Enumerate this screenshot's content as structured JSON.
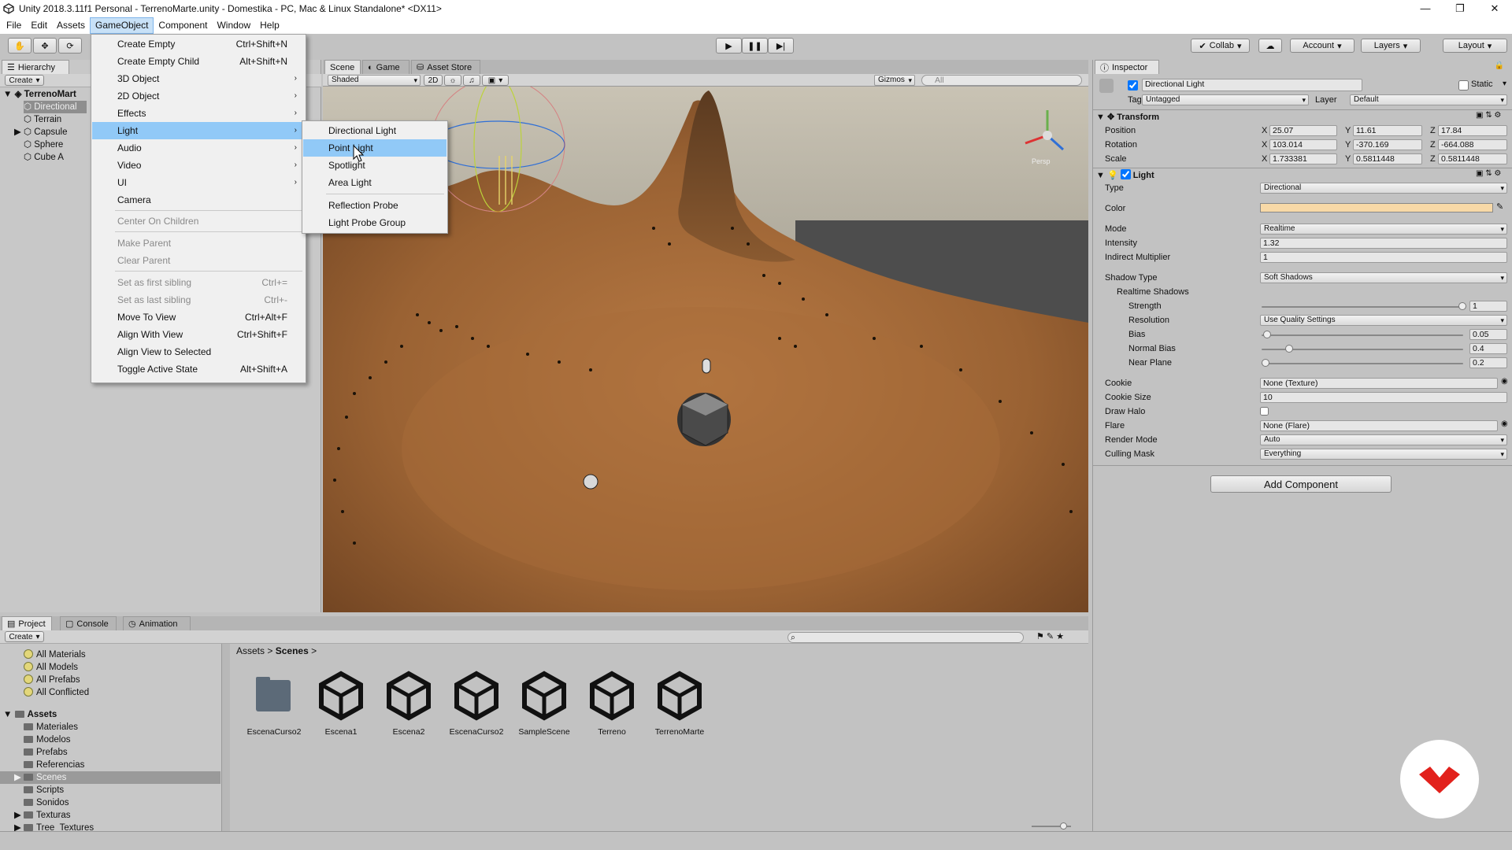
{
  "window": {
    "title": "Unity 2018.3.11f1 Personal - TerrenoMarte.unity - Domestika - PC, Mac & Linux Standalone* <DX11>",
    "controls": [
      "minimize-icon",
      "maximize-icon",
      "close-icon"
    ]
  },
  "menubar": [
    "File",
    "Edit",
    "Assets",
    "GameObject",
    "Component",
    "Window",
    "Help"
  ],
  "toolbar": {
    "collab": "Collab",
    "account": "Account",
    "layers": "Layers",
    "layout": "Layout"
  },
  "hierarchy": {
    "tab": "Hierarchy",
    "create": "Create",
    "scene_name": "TerrenoMart",
    "items": [
      "Directional",
      "Terrain",
      "Capsule",
      "Sphere",
      "Cube A"
    ]
  },
  "scene_view": {
    "tabs": [
      "Scene",
      "Game",
      "Asset Store"
    ],
    "shading": "Shaded",
    "mode_2d": "2D",
    "gizmos": "Gizmos",
    "search_placeholder": "All",
    "persp": "Persp"
  },
  "gameobject_menu": {
    "items": [
      {
        "label": "Create Empty",
        "shortcut": "Ctrl+Shift+N"
      },
      {
        "label": "Create Empty Child",
        "shortcut": "Alt+Shift+N"
      },
      {
        "label": "3D Object",
        "submenu": true
      },
      {
        "label": "2D Object",
        "submenu": true
      },
      {
        "label": "Effects",
        "submenu": true
      },
      {
        "label": "Light",
        "submenu": true
      },
      {
        "label": "Audio",
        "submenu": true
      },
      {
        "label": "Video",
        "submenu": true
      },
      {
        "label": "UI",
        "submenu": true
      },
      {
        "label": "Camera"
      },
      {
        "label": "Center On Children"
      },
      {
        "label": "Make Parent"
      },
      {
        "label": "Clear Parent"
      },
      {
        "label": "Set as first sibling",
        "shortcut": "Ctrl+="
      },
      {
        "label": "Set as last sibling",
        "shortcut": "Ctrl+-"
      },
      {
        "label": "Move To View",
        "shortcut": "Ctrl+Alt+F"
      },
      {
        "label": "Align With View",
        "shortcut": "Ctrl+Shift+F"
      },
      {
        "label": "Align View to Selected"
      },
      {
        "label": "Toggle Active State",
        "shortcut": "Alt+Shift+A"
      }
    ]
  },
  "light_submenu": [
    "Directional Light",
    "Point Light",
    "Spotlight",
    "Area Light",
    "Reflection Probe",
    "Light Probe Group"
  ],
  "inspector": {
    "tab": "Inspector",
    "object_name": "Directional Light",
    "static": "Static",
    "tag_label": "Tag",
    "tag": "Untagged",
    "layer_label": "Layer",
    "layer": "Default",
    "transform": {
      "title": "Transform",
      "position_label": "Position",
      "rotation_label": "Rotation",
      "scale_label": "Scale",
      "position": [
        "25.07",
        "11.61",
        "17.84"
      ],
      "rotation": [
        "103.014",
        "-370.169",
        "-664.088"
      ],
      "scale": [
        "1.733381",
        "0.5811448",
        "0.5811448"
      ]
    },
    "light": {
      "title": "Light",
      "type_label": "Type",
      "type": "Directional",
      "color_label": "Color",
      "color": "#f8d9a7",
      "mode_label": "Mode",
      "mode": "Realtime",
      "intensity_label": "Intensity",
      "intensity": "1.32",
      "indirect_label": "Indirect Multiplier",
      "indirect": "1",
      "shadow_type_label": "Shadow Type",
      "shadow_type": "Soft Shadows",
      "realtime_shadows": "Realtime Shadows",
      "strength_label": "Strength",
      "strength": "1",
      "resolution_label": "Resolution",
      "resolution": "Use Quality Settings",
      "bias_label": "Bias",
      "bias": "0.05",
      "normal_bias_label": "Normal Bias",
      "normal_bias": "0.4",
      "near_plane_label": "Near Plane",
      "near_plane": "0.2",
      "cookie_label": "Cookie",
      "cookie": "None (Texture)",
      "cookie_size_label": "Cookie Size",
      "cookie_size": "10",
      "draw_halo_label": "Draw Halo",
      "flare_label": "Flare",
      "flare": "None (Flare)",
      "render_mode_label": "Render Mode",
      "render_mode": "Auto",
      "culling_mask_label": "Culling Mask",
      "culling_mask": "Everything"
    },
    "add_component": "Add Component"
  },
  "project": {
    "tabs": [
      "Project",
      "Console",
      "Animation"
    ],
    "create": "Create",
    "favorites": [
      "All Materials",
      "All Models",
      "All Prefabs",
      "All Conflicted"
    ],
    "assets_root": "Assets",
    "folders": [
      "Materiales",
      "Modelos",
      "Prefabs",
      "Referencias",
      "Scenes",
      "Scripts",
      "Sonidos",
      "Texturas",
      "Tree_Textures"
    ],
    "breadcrumb": [
      "Assets",
      "Scenes"
    ],
    "assets": [
      "EscenaCurso2",
      "Escena1",
      "Escena2",
      "EscenaCurso2",
      "SampleScene",
      "Terreno",
      "TerrenoMarte"
    ]
  }
}
